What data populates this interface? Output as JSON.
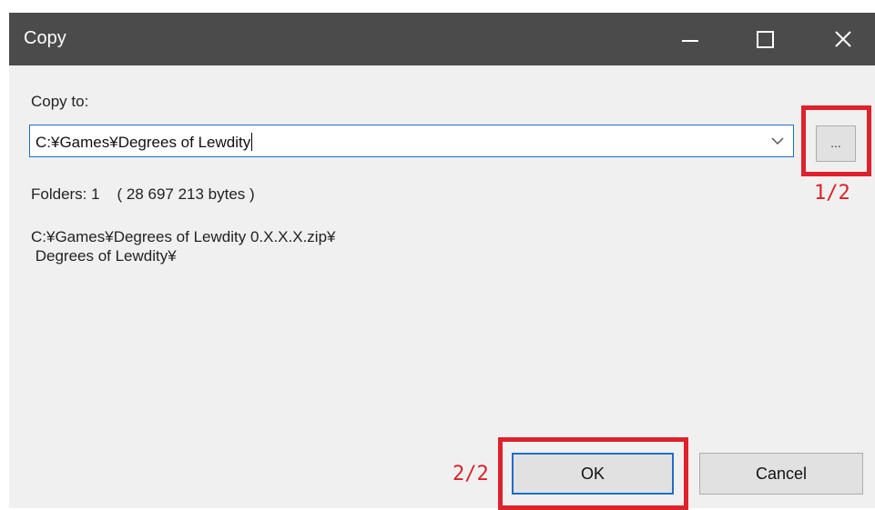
{
  "window": {
    "title": "Copy"
  },
  "form": {
    "copy_to_label": "Copy to:",
    "path_value": "C:¥Games¥Degrees of Lewdity",
    "browse_label": "...",
    "folders_info": "Folders: 1    ( 28 697 213 bytes )",
    "source_line1": "C:¥Games¥Degrees of Lewdity 0.X.X.X.zip¥",
    "source_line2": " Degrees of Lewdity¥"
  },
  "buttons": {
    "ok_label": "OK",
    "cancel_label": "Cancel"
  },
  "annotations": {
    "step_browse": "1/2",
    "step_ok": "2/2",
    "highlight_color": "#e0212b"
  },
  "colors": {
    "titlebar": "#4b4b4b",
    "focus_border": "#1e6ec8",
    "dialog_bg": "#f0f0f0"
  },
  "icons": {
    "minimize": "minimize-icon",
    "maximize": "maximize-icon",
    "close": "close-icon",
    "dropdown": "chevron-down-icon"
  }
}
